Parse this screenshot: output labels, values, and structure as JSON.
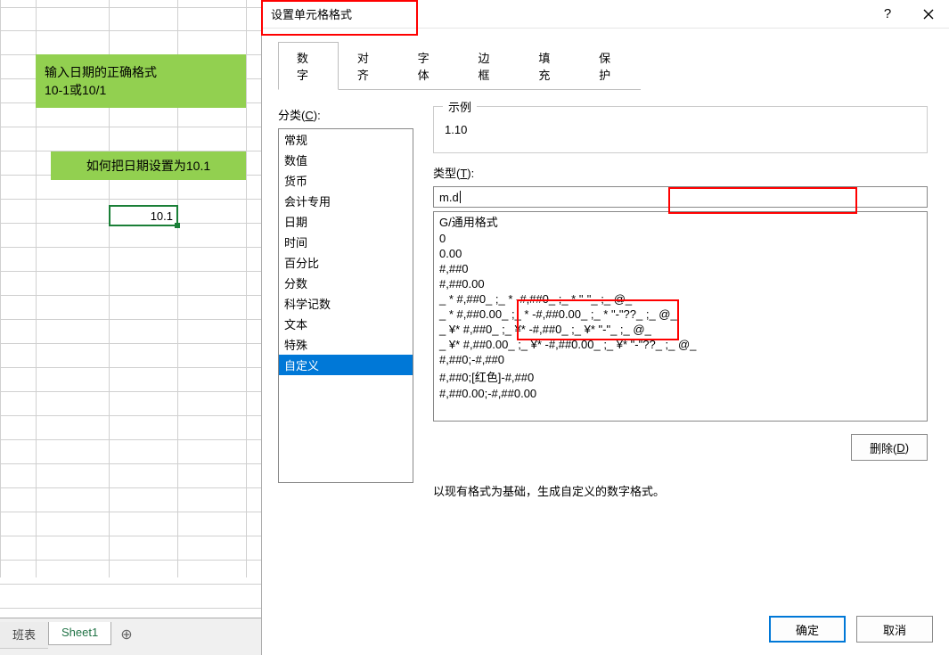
{
  "sheet": {
    "green1_line1": "输入日期的正确格式",
    "green1_line2": "10-1或10/1",
    "green2": "如何把日期设置为10.1",
    "selected_value": "10.1",
    "tabs": {
      "tab1": "班表",
      "tab2": "Sheet1",
      "add": "⊕"
    }
  },
  "dialog": {
    "title": "设置单元格格式",
    "help": "?",
    "tabs": {
      "number": "数字",
      "align": "对齐",
      "font": "字体",
      "border": "边框",
      "fill": "填充",
      "protect": "保护"
    },
    "category_label": "分类(C):",
    "categories": [
      "常规",
      "数值",
      "货币",
      "会计专用",
      "日期",
      "时间",
      "百分比",
      "分数",
      "科学记数",
      "文本",
      "特殊",
      "自定义"
    ],
    "selected_category_index": 11,
    "example_label": "示例",
    "example_value": "1.10",
    "type_label": "类型(T):",
    "type_value": "m.d",
    "format_list": [
      "G/通用格式",
      "0",
      "0.00",
      "#,##0",
      "#,##0.00",
      "_ * #,##0_ ;_ * -#,##0_ ;_ * \"-\"_ ;_ @_ ",
      "_ * #,##0.00_ ;_ * -#,##0.00_ ;_ * \"-\"??_ ;_ @_ ",
      "_ ¥* #,##0_ ;_ ¥* -#,##0_ ;_ ¥* \"-\"_ ;_ @_ ",
      "_ ¥* #,##0.00_ ;_ ¥* -#,##0.00_ ;_ ¥* \"-\"??_ ;_ @_ ",
      "#,##0;-#,##0",
      "#,##0;[红色]-#,##0",
      "#,##0.00;-#,##0.00"
    ],
    "delete_label": "删除(D)",
    "hint": "以现有格式为基础，生成自定义的数字格式。",
    "ok": "确定",
    "cancel": "取消"
  }
}
